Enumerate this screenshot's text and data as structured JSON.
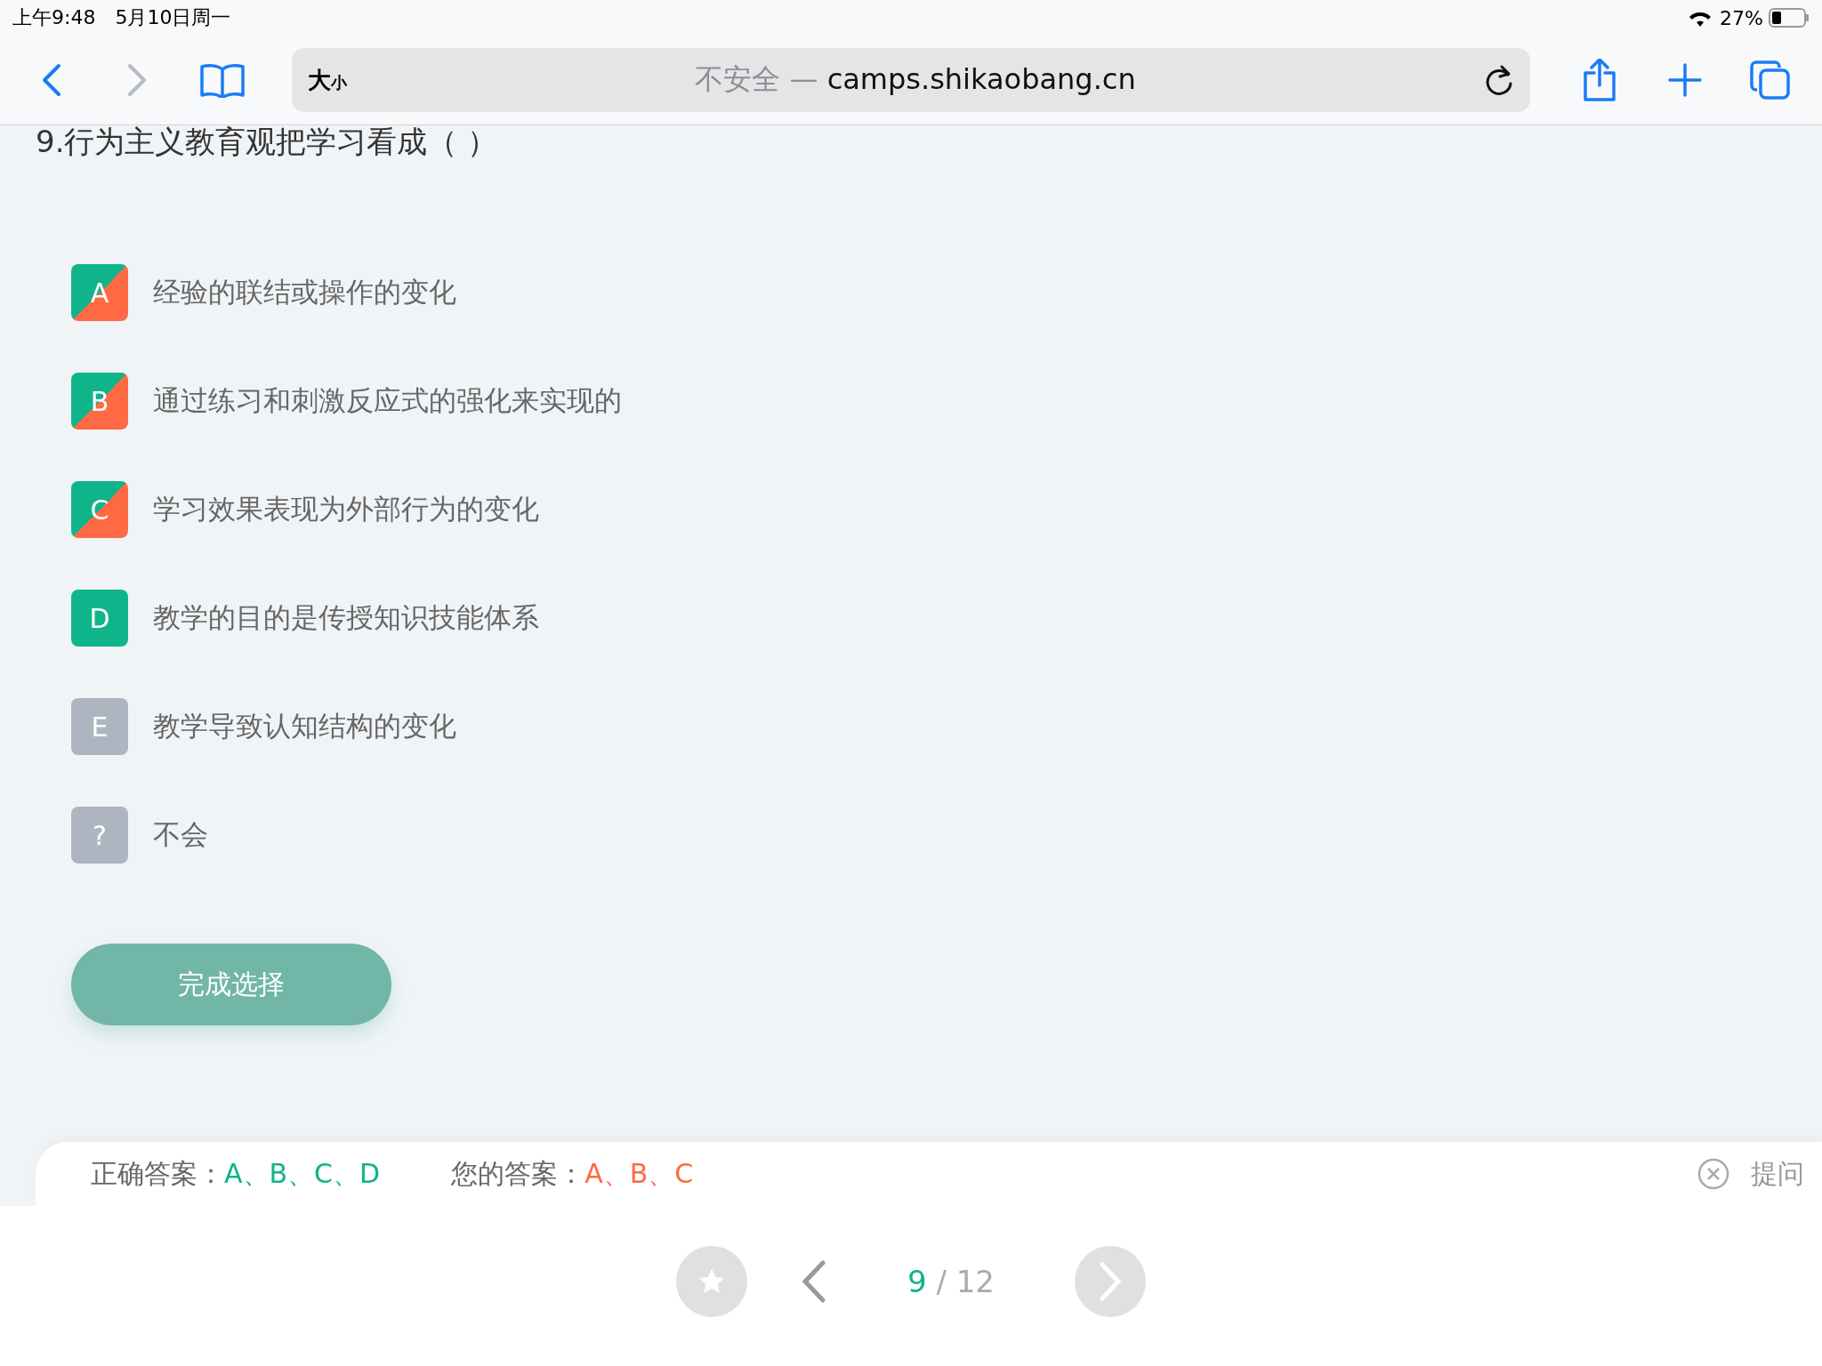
{
  "status_bar": {
    "time": "上午9:48",
    "date": "5月10日周一",
    "battery": "27%"
  },
  "browser": {
    "back_enabled": true,
    "forward_enabled": false,
    "text_size": {
      "large": "大",
      "small": "小"
    },
    "security": "不安全 —",
    "host": "camps.shikaobang.cn"
  },
  "question": "9.行为主义教育观把学习看成（ ）",
  "options": [
    {
      "letter": "A",
      "text": "经验的联结或操作的变化",
      "correct": true,
      "chosen": true
    },
    {
      "letter": "B",
      "text": "通过练习和刺激反应式的强化来实现的",
      "correct": true,
      "chosen": true
    },
    {
      "letter": "C",
      "text": "学习效果表现为外部行为的变化",
      "correct": true,
      "chosen": true
    },
    {
      "letter": "D",
      "text": "教学的目的是传授知识技能体系",
      "correct": true,
      "chosen": false
    },
    {
      "letter": "E",
      "text": "教学导致认知结构的变化",
      "correct": false,
      "chosen": false
    },
    {
      "letter": "?",
      "text": "不会",
      "correct": false,
      "chosen": false
    }
  ],
  "submit_button": "完成选择",
  "answer_bar": {
    "correct_label": "正确答案：",
    "correct_value": "A、B、C、D",
    "yours_label": "您的答案：",
    "yours_value": "A、B、C",
    "ask": "提问"
  },
  "pager": {
    "current": "9",
    "total": "/ 12"
  }
}
